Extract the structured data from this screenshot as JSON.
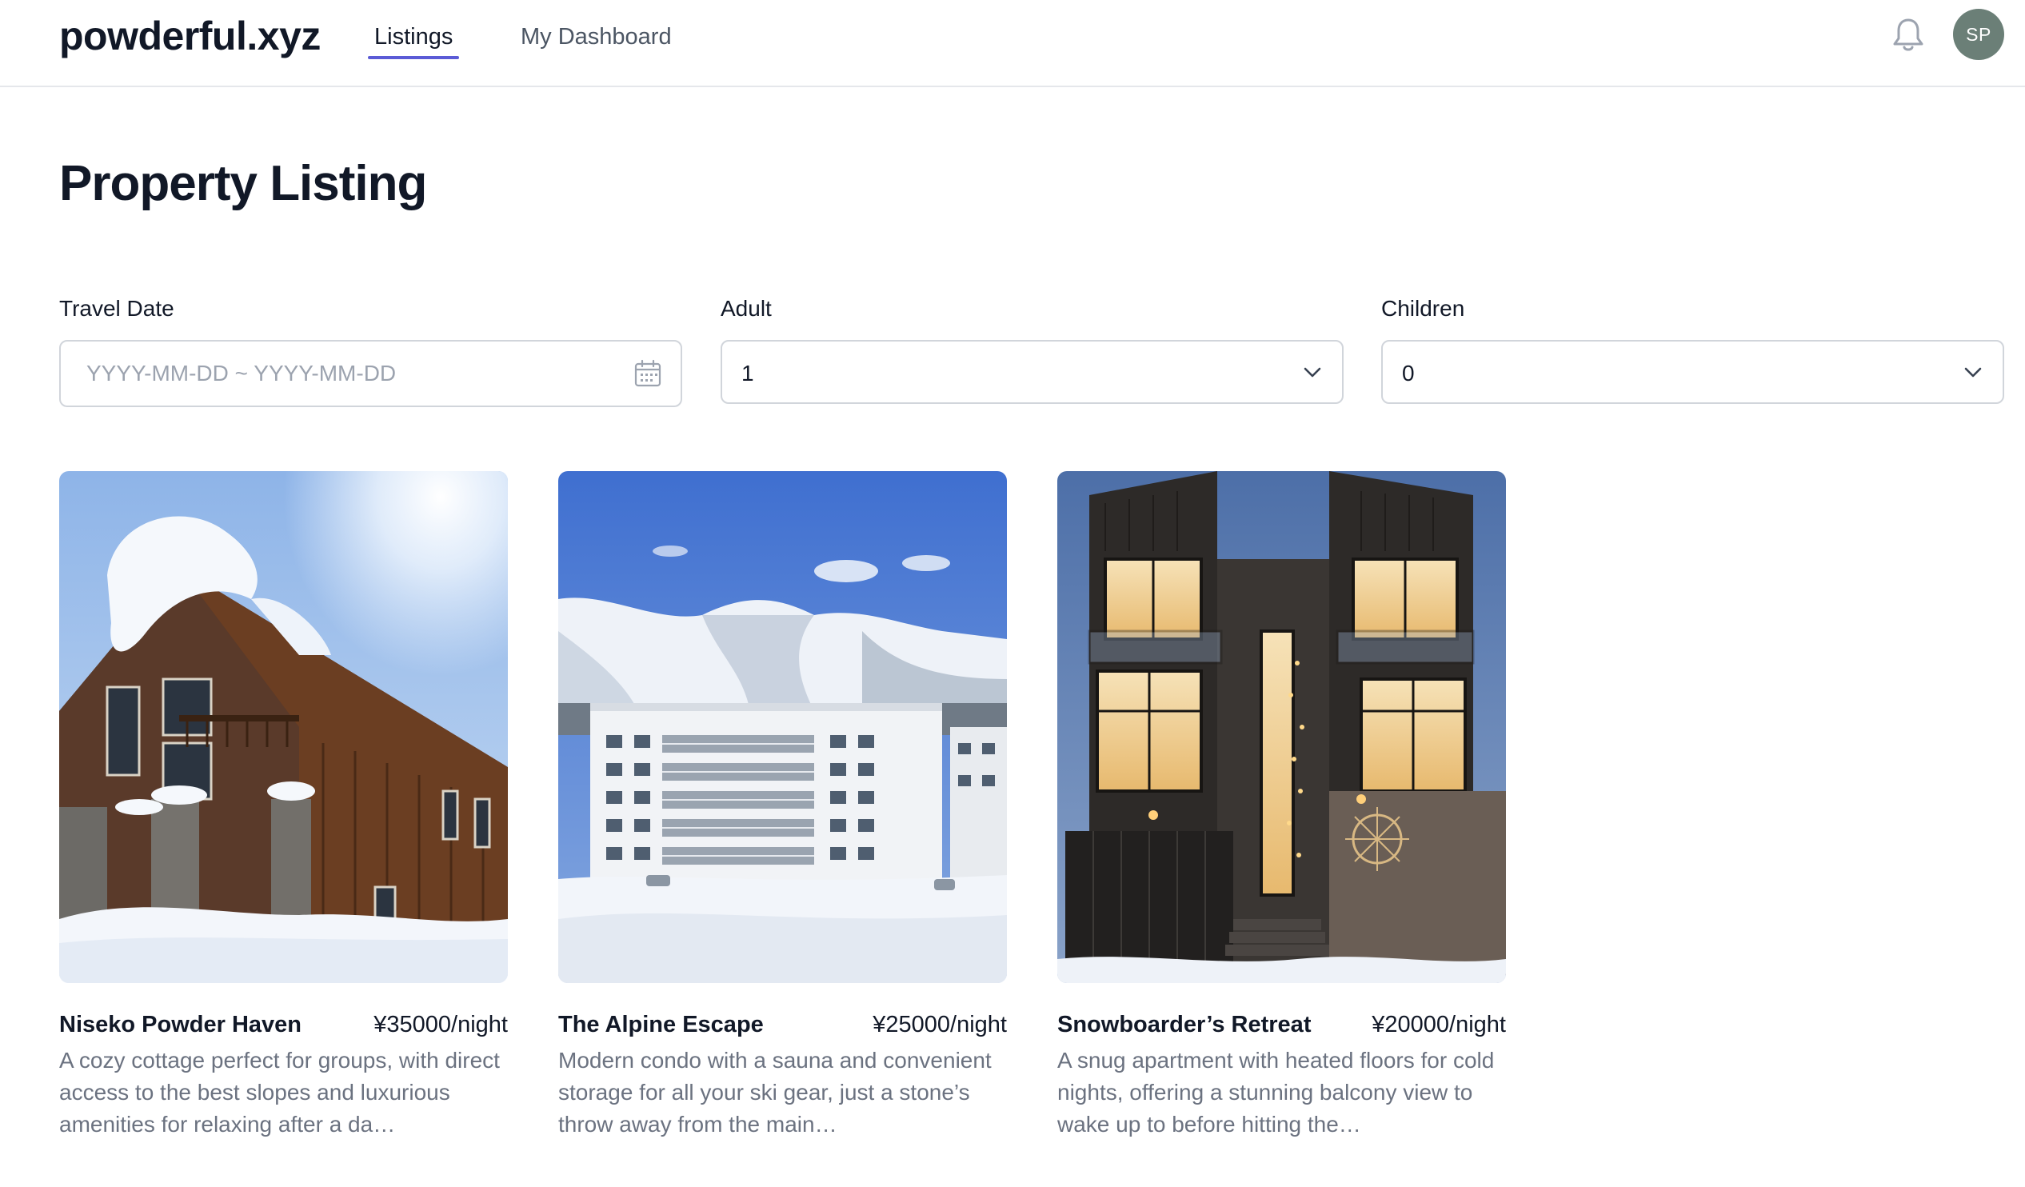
{
  "header": {
    "brand": "powderful.xyz",
    "tabs": [
      {
        "label": "Listings",
        "active": true
      },
      {
        "label": "My Dashboard",
        "active": false
      }
    ],
    "avatar_initials": "SP",
    "icons": {
      "notifications": "bell-icon"
    }
  },
  "page": {
    "title": "Property Listing"
  },
  "filters": {
    "travel_date": {
      "label": "Travel Date",
      "placeholder": "YYYY-MM-DD ~ YYYY-MM-DD",
      "icon": "calendar-icon"
    },
    "adult": {
      "label": "Adult",
      "value": "1",
      "icon": "chevron-down-icon"
    },
    "children": {
      "label": "Children",
      "value": "0",
      "icon": "chevron-down-icon"
    }
  },
  "listings": [
    {
      "name": "Niseko Powder Haven",
      "price": "¥35000/night",
      "description": "A cozy cottage perfect for groups, with direct access to the best slopes and luxurious amenities for relaxing after a da…"
    },
    {
      "name": "The Alpine Escape",
      "price": "¥25000/night",
      "description": "Modern condo with a sauna and convenient storage for all your ski gear, just a stone’s throw away from the main…"
    },
    {
      "name": "Snowboarder’s Retreat",
      "price": "¥20000/night",
      "description": "A snug apartment with heated floors for cold nights, offering a stunning balcony view to wake up to before hitting the…"
    }
  ],
  "colors": {
    "accent": "#5b5bd6",
    "avatar_bg": "#6b7f77",
    "border": "#d1d5db"
  }
}
